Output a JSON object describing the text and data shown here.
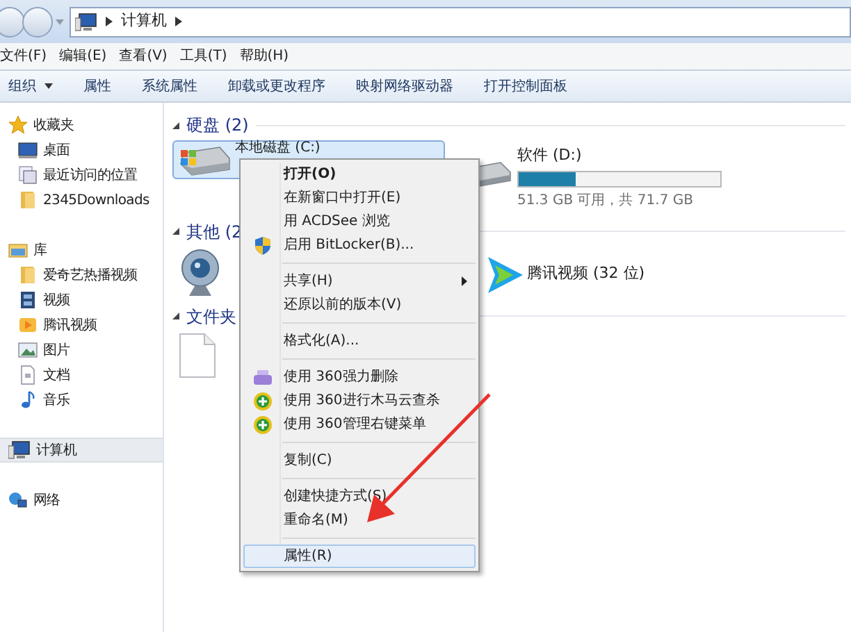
{
  "address_bar": {
    "path": [
      "计算机"
    ]
  },
  "menu_bar": [
    "文件(F)",
    "编辑(E)",
    "查看(V)",
    "工具(T)",
    "帮助(H)"
  ],
  "toolbar": [
    {
      "label": "组织",
      "dropdown": true
    },
    {
      "label": "属性",
      "dropdown": false
    },
    {
      "label": "系统属性",
      "dropdown": false
    },
    {
      "label": "卸载或更改程序",
      "dropdown": false
    },
    {
      "label": "映射网络驱动器",
      "dropdown": false
    },
    {
      "label": "打开控制面板",
      "dropdown": false
    }
  ],
  "sidebar": {
    "groups": [
      {
        "label": "收藏夹",
        "kind": "star",
        "selected": false,
        "children": [
          {
            "label": "桌面",
            "kind": "desktop",
            "selected": false
          },
          {
            "label": "最近访问的位置",
            "kind": "recent",
            "selected": false
          },
          {
            "label": "2345Downloads",
            "kind": "folder",
            "selected": false
          }
        ]
      },
      {
        "label": "库",
        "kind": "library",
        "selected": false,
        "children": [
          {
            "label": "爱奇艺热播视频",
            "kind": "folder",
            "selected": false
          },
          {
            "label": "视频",
            "kind": "video",
            "selected": false
          },
          {
            "label": "腾讯视频",
            "kind": "tvideo",
            "selected": false
          },
          {
            "label": "图片",
            "kind": "picture",
            "selected": false
          },
          {
            "label": "文档",
            "kind": "document",
            "selected": false
          },
          {
            "label": "音乐",
            "kind": "music",
            "selected": false
          }
        ]
      },
      {
        "label": "计算机",
        "kind": "computer",
        "selected": true
      },
      {
        "label": "网络",
        "kind": "network",
        "selected": false
      }
    ]
  },
  "sections": [
    {
      "title": "硬盘 (2)",
      "items": [
        {
          "kind": "drive",
          "label": "本地磁盘 (C:)",
          "selected": true
        },
        {
          "kind": "drive",
          "label": "软件 (D:)",
          "selected": false,
          "level": 0.28,
          "space": "51.3 GB 可用，共 71.7 GB"
        }
      ]
    },
    {
      "title": "其他 (2",
      "items": [
        {
          "kind": "webcam",
          "selected": false
        },
        {
          "kind": "tvideo",
          "label": "腾讯视频 (32 位)",
          "selected": false
        }
      ]
    },
    {
      "title": "文件夹",
      "items": [
        {
          "kind": "file",
          "selected": false
        }
      ]
    }
  ],
  "context_menu": {
    "groups": [
      [
        {
          "label": "打开(O)",
          "default": true,
          "kind": "plain",
          "submenu": false,
          "selected": false
        },
        {
          "label": "在新窗口中打开(E)",
          "default": false,
          "kind": "plain",
          "submenu": false,
          "selected": false
        },
        {
          "label": "用 ACDSee 浏览",
          "default": false,
          "kind": "plain",
          "submenu": false,
          "selected": false
        },
        {
          "label": "启用 BitLocker(B)...",
          "default": false,
          "kind": "shield",
          "submenu": false,
          "selected": false
        }
      ],
      [
        {
          "label": "共享(H)",
          "default": false,
          "kind": "plain",
          "submenu": true,
          "selected": false
        },
        {
          "label": "还原以前的版本(V)",
          "default": false,
          "kind": "plain",
          "submenu": false,
          "selected": false
        }
      ],
      [
        {
          "label": "格式化(A)...",
          "default": false,
          "kind": "plain",
          "submenu": false,
          "selected": false
        }
      ],
      [
        {
          "label": "使用 360强力删除",
          "default": false,
          "kind": "shredder",
          "submenu": false,
          "selected": false
        },
        {
          "label": "使用 360进行木马云查杀",
          "default": false,
          "kind": "guard",
          "submenu": false,
          "selected": false
        },
        {
          "label": "使用 360管理右键菜单",
          "default": false,
          "kind": "guard",
          "submenu": false,
          "selected": false
        }
      ],
      [
        {
          "label": "复制(C)",
          "default": false,
          "kind": "plain",
          "submenu": false,
          "selected": false
        }
      ],
      [
        {
          "label": "创建快捷方式(S)",
          "default": false,
          "kind": "plain",
          "submenu": false,
          "selected": false
        },
        {
          "label": "重命名(M)",
          "default": false,
          "kind": "plain",
          "submenu": false,
          "selected": false
        }
      ],
      [
        {
          "label": "属性(R)",
          "default": false,
          "kind": "plain",
          "submenu": false,
          "selected": true
        }
      ]
    ]
  }
}
